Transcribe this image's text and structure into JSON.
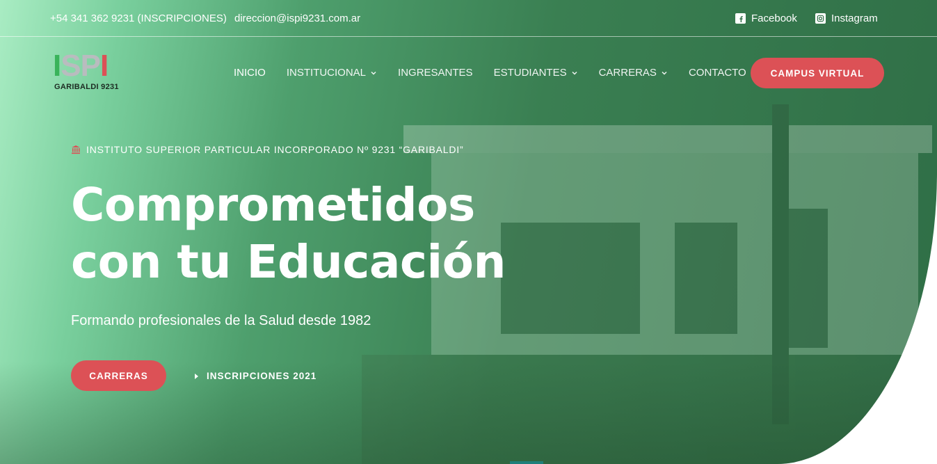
{
  "topbar": {
    "phone": "+54 341 362 9231 (INSCRIPCIONES)",
    "email": "direccion@ispi9231.com.ar",
    "facebook_label": "Facebook",
    "instagram_label": "Instagram",
    "facebook_icon": "facebook-icon",
    "instagram_icon": "instagram-icon"
  },
  "logo": {
    "letters": [
      "I",
      "S",
      "P",
      "I"
    ],
    "letter_colors": [
      "#39b35a",
      "#b9bcbf",
      "#b9bcbf",
      "#dc5156"
    ],
    "subtitle": "GARIBALDI 9231"
  },
  "nav": {
    "items": [
      {
        "label": "INICIO",
        "dropdown": false,
        "active": true
      },
      {
        "label": "INSTITUCIONAL",
        "dropdown": true
      },
      {
        "label": "INGRESANTES",
        "dropdown": false
      },
      {
        "label": "ESTUDIANTES",
        "dropdown": true
      },
      {
        "label": "CARRERAS",
        "dropdown": true
      },
      {
        "label": "CONTACTO",
        "dropdown": false
      }
    ],
    "cta": "CAMPUS VIRTUAL"
  },
  "hero": {
    "eyebrow": "INSTITUTO SUPERIOR PARTICULAR INCORPORADO Nº 9231 “GARIBALDI”",
    "eyebrow_icon": "institution-icon",
    "headline_line1": "Comprometidos",
    "headline_line2": "con tu Educación",
    "subtitle": "Formando profesionales de la Salud desde 1982",
    "primary_button": "CARRERAS",
    "secondary_link": "INSCRIPCIONES 2021",
    "secondary_icon": "play-arrow-icon"
  },
  "colors": {
    "accent": "#dc5156",
    "hero_green_dark": "#2f6e46",
    "hero_green_light": "#a9ecc3"
  }
}
